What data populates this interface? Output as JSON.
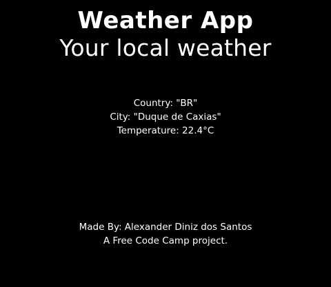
{
  "header": {
    "title": "Weather App",
    "subtitle": "Your local weather"
  },
  "weather": {
    "country_line": "Country: \"BR\"",
    "city_line": "City: \"Duque de Caxias\"",
    "temperature_line": "Temperature: 22.4°C"
  },
  "footer": {
    "author_line": "Made By: Alexander Diniz dos Santos",
    "project_line": "A Free Code Camp project."
  },
  "colors": {
    "background": "#000000",
    "text": "#ffffff"
  }
}
